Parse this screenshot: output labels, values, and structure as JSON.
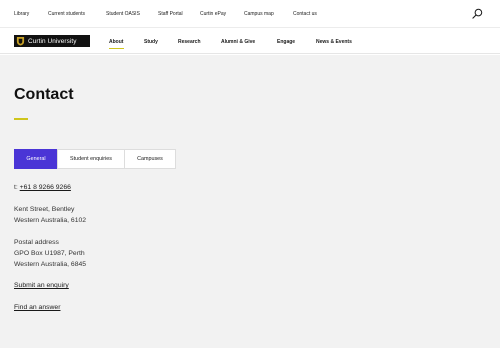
{
  "utility_nav": [
    "Library",
    "Current students",
    "Student OASIS",
    "Staff Portal",
    "Curtin ePay",
    "Campus map",
    "Contact us"
  ],
  "logo": {
    "text": "Curtin University"
  },
  "main_nav": [
    "About",
    "Study",
    "Research",
    "Alumni & Give",
    "Engage",
    "News & Events"
  ],
  "page": {
    "title": "Contact"
  },
  "tabs": [
    "General",
    "Student enquiries",
    "Campuses"
  ],
  "contact": {
    "phone_prefix": "t:",
    "phone": "+61 8 9266 9266",
    "street_line1": "Kent Street, Bentley",
    "street_line2": "Western Australia, 6102",
    "postal_heading": "Postal address",
    "postal_line1": "GPO Box U1987, Perth",
    "postal_line2": "Western Australia, 6845",
    "enquiry_link": "Submit an enquiry",
    "answer_link": "Find an answer"
  },
  "colors": {
    "accent_yellow": "#cfc51c",
    "active_tab": "#4a35d6",
    "content_bg": "#f2f2f2"
  },
  "icons": {
    "search": "magnifier-icon",
    "crest": "shield-crest-icon"
  }
}
